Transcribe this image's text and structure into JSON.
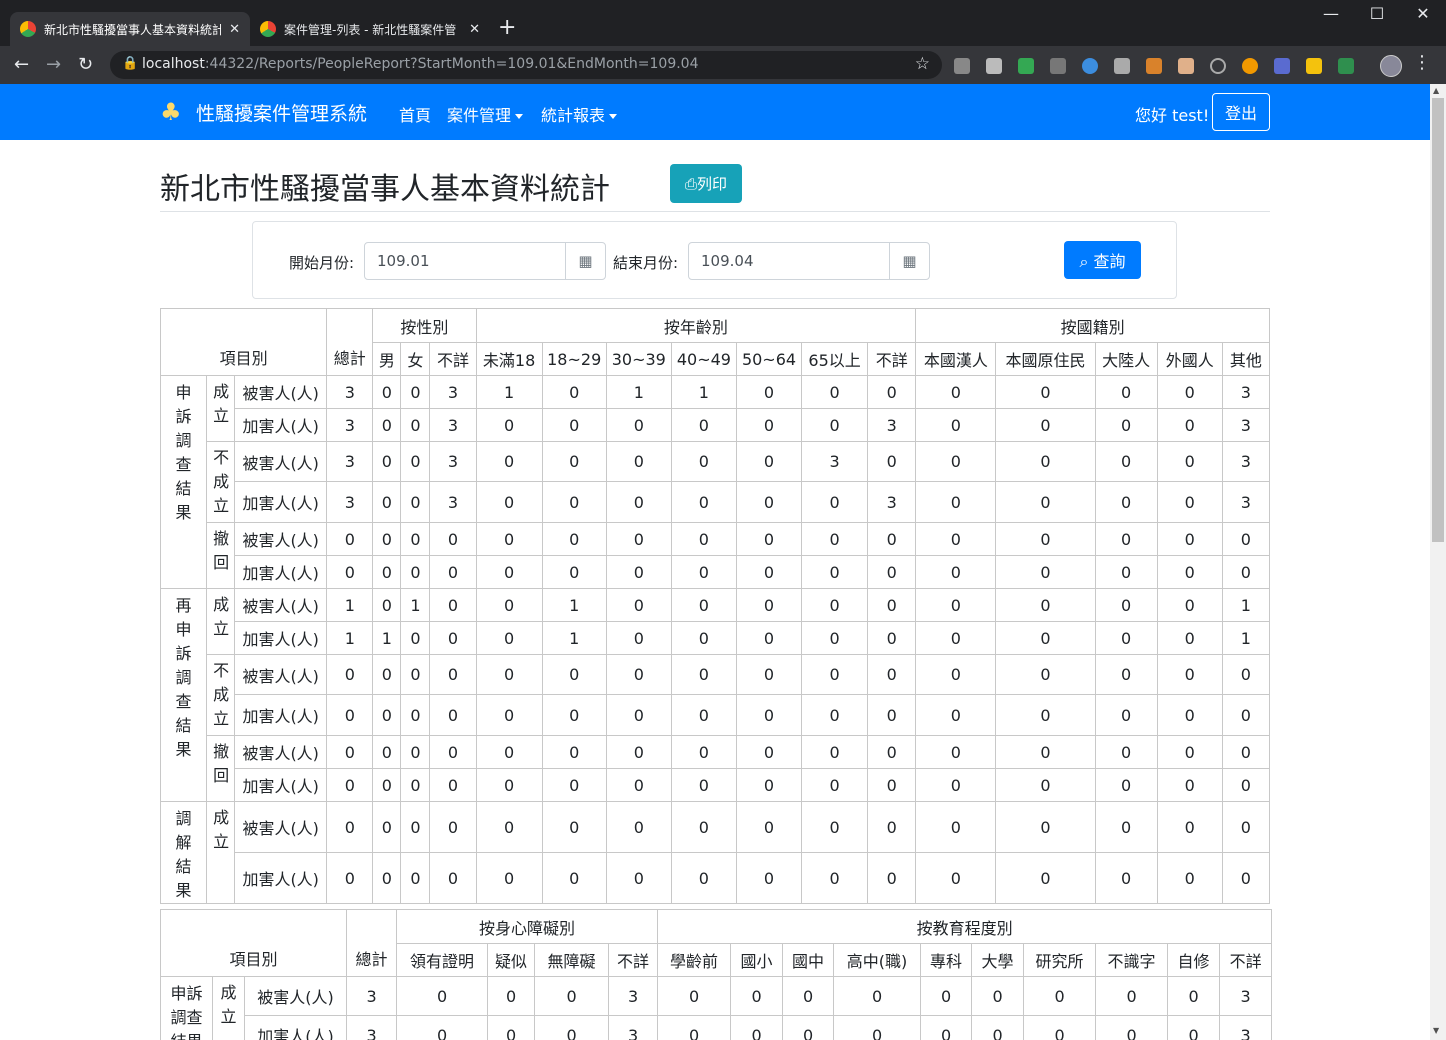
{
  "browser": {
    "tabs": [
      {
        "title": "新北市性騷擾當事人基本資料統計"
      },
      {
        "title": "案件管理-列表 - 新北性騷案件管"
      }
    ],
    "new_tab": "+",
    "url_host": "localhost",
    "url_rest": ":44322/Reports/PeopleReport?StartMonth=109.01&EndMonth=109.04"
  },
  "navbar": {
    "brand": "性騷擾案件管理系統",
    "home": "首頁",
    "case_mgmt": "案件管理",
    "reports": "統計報表",
    "greeting": "您好 test!",
    "logout": "登出"
  },
  "page": {
    "title": "新北市性騷擾當事人基本資料統計",
    "print": "列印"
  },
  "search": {
    "start_label": "開始月份:",
    "start_value": "109.01",
    "end_label": "結束月份:",
    "end_value": "109.04",
    "submit": "查詢"
  },
  "table1": {
    "item_header": "項目別",
    "total_header": "總計",
    "groups": {
      "gender": "按性別",
      "age": "按年齡別",
      "nationality": "按國籍別"
    },
    "columns": [
      "男",
      "女",
      "不詳",
      "未滿18",
      "18~29",
      "30~39",
      "40~49",
      "50~64",
      "65以上",
      "不詳",
      "本國漢人",
      "本國原住民",
      "大陸人",
      "外國人",
      "其他"
    ],
    "sections": [
      {
        "name": "申訴調查結果",
        "subgroups": [
          {
            "name": "成立",
            "rows": [
              {
                "role": "被害人(人)",
                "values": [
                  3,
                  0,
                  0,
                  3,
                  1,
                  0,
                  1,
                  1,
                  0,
                  0,
                  0,
                  0,
                  0,
                  0,
                  0,
                  3
                ]
              },
              {
                "role": "加害人(人)",
                "values": [
                  3,
                  0,
                  0,
                  3,
                  0,
                  0,
                  0,
                  0,
                  0,
                  0,
                  3,
                  0,
                  0,
                  0,
                  0,
                  3
                ]
              }
            ]
          },
          {
            "name": "不成立",
            "rows": [
              {
                "role": "被害人(人)",
                "values": [
                  3,
                  0,
                  0,
                  3,
                  0,
                  0,
                  0,
                  0,
                  0,
                  3,
                  0,
                  0,
                  0,
                  0,
                  0,
                  3
                ]
              },
              {
                "role": "加害人(人)",
                "values": [
                  3,
                  0,
                  0,
                  3,
                  0,
                  0,
                  0,
                  0,
                  0,
                  0,
                  3,
                  0,
                  0,
                  0,
                  0,
                  3
                ]
              }
            ]
          },
          {
            "name": "撤回",
            "rows": [
              {
                "role": "被害人(人)",
                "values": [
                  0,
                  0,
                  0,
                  0,
                  0,
                  0,
                  0,
                  0,
                  0,
                  0,
                  0,
                  0,
                  0,
                  0,
                  0,
                  0
                ]
              },
              {
                "role": "加害人(人)",
                "values": [
                  0,
                  0,
                  0,
                  0,
                  0,
                  0,
                  0,
                  0,
                  0,
                  0,
                  0,
                  0,
                  0,
                  0,
                  0,
                  0
                ]
              }
            ]
          }
        ]
      },
      {
        "name": "再申訴調查結果",
        "subgroups": [
          {
            "name": "成立",
            "rows": [
              {
                "role": "被害人(人)",
                "values": [
                  1,
                  0,
                  1,
                  0,
                  0,
                  1,
                  0,
                  0,
                  0,
                  0,
                  0,
                  0,
                  0,
                  0,
                  0,
                  1
                ]
              },
              {
                "role": "加害人(人)",
                "values": [
                  1,
                  1,
                  0,
                  0,
                  0,
                  1,
                  0,
                  0,
                  0,
                  0,
                  0,
                  0,
                  0,
                  0,
                  0,
                  1
                ]
              }
            ]
          },
          {
            "name": "不成立",
            "rows": [
              {
                "role": "被害人(人)",
                "values": [
                  0,
                  0,
                  0,
                  0,
                  0,
                  0,
                  0,
                  0,
                  0,
                  0,
                  0,
                  0,
                  0,
                  0,
                  0,
                  0
                ]
              },
              {
                "role": "加害人(人)",
                "values": [
                  0,
                  0,
                  0,
                  0,
                  0,
                  0,
                  0,
                  0,
                  0,
                  0,
                  0,
                  0,
                  0,
                  0,
                  0,
                  0
                ]
              }
            ]
          },
          {
            "name": "撤回",
            "rows": [
              {
                "role": "被害人(人)",
                "values": [
                  0,
                  0,
                  0,
                  0,
                  0,
                  0,
                  0,
                  0,
                  0,
                  0,
                  0,
                  0,
                  0,
                  0,
                  0,
                  0
                ]
              },
              {
                "role": "加害人(人)",
                "values": [
                  0,
                  0,
                  0,
                  0,
                  0,
                  0,
                  0,
                  0,
                  0,
                  0,
                  0,
                  0,
                  0,
                  0,
                  0,
                  0
                ]
              }
            ]
          }
        ]
      },
      {
        "name": "調解結果",
        "subgroups": [
          {
            "name": "成立",
            "rows": [
              {
                "role": "被害人(人)",
                "values": [
                  0,
                  0,
                  0,
                  0,
                  0,
                  0,
                  0,
                  0,
                  0,
                  0,
                  0,
                  0,
                  0,
                  0,
                  0,
                  0
                ]
              },
              {
                "role": "加害人(人)",
                "values": [
                  0,
                  0,
                  0,
                  0,
                  0,
                  0,
                  0,
                  0,
                  0,
                  0,
                  0,
                  0,
                  0,
                  0,
                  0,
                  0
                ]
              }
            ]
          }
        ]
      }
    ]
  },
  "table2": {
    "item_header": "項目別",
    "total_header": "總計",
    "groups": {
      "disability": "按身心障礙別",
      "education": "按教育程度別"
    },
    "columns": [
      "領有證明",
      "疑似",
      "無障礙",
      "不詳",
      "學齡前",
      "國小",
      "國中",
      "高中(職)",
      "專科",
      "大學",
      "研究所",
      "不識字",
      "自修",
      "不詳"
    ],
    "section_name": "申訴調查結果",
    "subgroup_name": "成立",
    "rows": [
      {
        "role": "被害人(人)",
        "values": [
          3,
          0,
          0,
          0,
          3,
          0,
          0,
          0,
          0,
          0,
          0,
          0,
          0,
          0,
          3
        ]
      },
      {
        "role": "加害人(人)",
        "values": [
          3,
          0,
          0,
          0,
          3,
          0,
          0,
          0,
          0,
          0,
          0,
          0,
          0,
          0,
          3
        ]
      }
    ]
  }
}
